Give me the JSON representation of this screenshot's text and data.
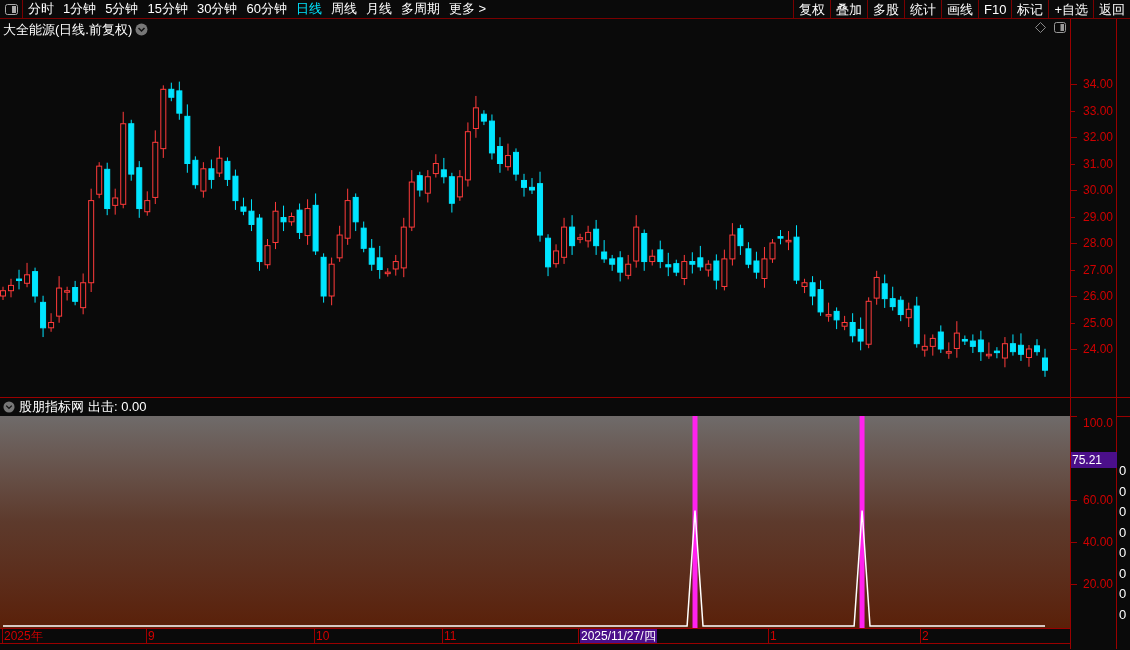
{
  "toolbar": {
    "periods": [
      {
        "label": "分时",
        "selected": false
      },
      {
        "label": "1分钟",
        "selected": false
      },
      {
        "label": "5分钟",
        "selected": false
      },
      {
        "label": "15分钟",
        "selected": false
      },
      {
        "label": "30分钟",
        "selected": false
      },
      {
        "label": "60分钟",
        "selected": false
      },
      {
        "label": "日线",
        "selected": true
      },
      {
        "label": "周线",
        "selected": false
      },
      {
        "label": "月线",
        "selected": false
      },
      {
        "label": "多周期",
        "selected": false
      },
      {
        "label": "更多 >",
        "selected": false
      }
    ],
    "buttons": [
      "复权",
      "叠加",
      "多股",
      "统计",
      "画线",
      "F10",
      "标记",
      "+自选",
      "返回"
    ]
  },
  "main_chart": {
    "title": "大全能源(日线.前复权)",
    "price_axis": [
      "34.00",
      "33.00",
      "32.00",
      "31.00",
      "30.00",
      "29.00",
      "28.00",
      "27.00",
      "26.00",
      "25.00",
      "24.00"
    ]
  },
  "indicator": {
    "title": "股朋指标网",
    "output": "出击: 0.00",
    "current_value": "75.21",
    "chart_data": {
      "type": "line",
      "ylim": [
        0,
        100
      ],
      "yticks": [
        {
          "value": 100,
          "label": "100.0"
        },
        {
          "value": 60,
          "label": "60.00"
        },
        {
          "value": 40,
          "label": "40.00"
        },
        {
          "value": 20,
          "label": "20.00"
        }
      ],
      "series": [
        {
          "color": "#ffffff",
          "values": [
            0,
            0,
            0,
            0,
            0,
            0,
            0,
            0,
            0,
            0,
            0,
            0,
            0,
            0,
            0,
            0,
            0,
            0,
            0,
            0,
            0,
            0,
            0,
            0,
            0,
            0,
            0,
            0,
            0,
            0,
            0,
            0,
            0,
            0,
            0,
            0,
            0,
            0,
            0,
            0,
            0,
            0,
            0,
            0,
            0,
            0,
            0,
            0,
            0,
            0,
            0,
            0,
            0,
            0,
            0,
            0,
            0,
            0,
            0,
            0,
            0,
            0,
            0,
            0,
            0,
            0,
            0,
            0,
            0,
            0,
            0,
            0,
            0,
            0,
            0,
            0,
            0,
            0,
            0,
            0,
            0,
            0,
            0,
            0,
            0,
            0,
            0,
            55,
            0,
            0,
            0,
            0,
            0,
            0,
            0,
            0,
            0,
            0,
            0,
            0,
            0,
            0,
            0,
            0,
            0,
            0,
            0,
            0,
            55,
            0,
            0,
            0,
            0,
            0,
            0,
            0,
            0,
            0,
            0,
            0,
            0,
            0,
            0,
            0,
            0,
            0,
            0,
            0,
            0,
            0,
            0,
            0
          ]
        }
      ]
    }
  },
  "date_axis": [
    {
      "label": "2025年",
      "selected": false
    },
    {
      "label": "9",
      "selected": false
    },
    {
      "label": "10",
      "selected": false
    },
    {
      "label": "11",
      "selected": false
    },
    {
      "label": "2025/11/27/四",
      "selected": true
    },
    {
      "label": "1",
      "selected": false
    },
    {
      "label": "2",
      "selected": false
    }
  ],
  "side_panel": [
    "0",
    "0",
    "0",
    "0",
    "0",
    "0",
    "0",
    "0"
  ]
}
